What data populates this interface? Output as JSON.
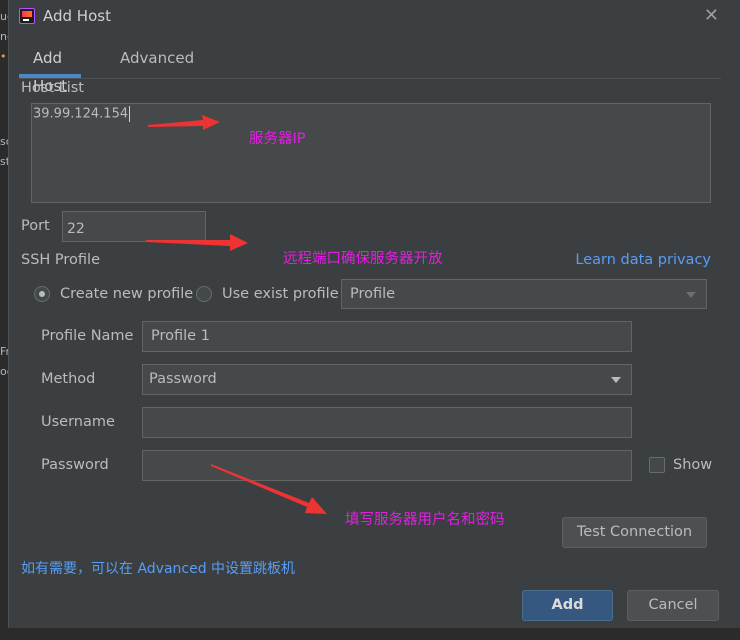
{
  "dialog": {
    "title": "Add Host",
    "tabs": [
      {
        "label": "Add Host",
        "active": true
      },
      {
        "label": "Advanced",
        "active": false
      }
    ]
  },
  "host_list": {
    "label": "Host List",
    "value": "39.99.124.154"
  },
  "port": {
    "label": "Port",
    "value": "22"
  },
  "ssh_profile": {
    "label": "SSH Profile",
    "privacy_link": "Learn data privacy",
    "create_new_label": "Create new profile",
    "use_exist_label": "Use exist profile",
    "profile_select": "Profile",
    "selected_option": "Create new profile"
  },
  "form": {
    "profile_name_label": "Profile Name",
    "profile_name_value": "Profile 1",
    "method_label": "Method",
    "method_value": "Password",
    "username_label": "Username",
    "username_value": "",
    "password_label": "Password",
    "password_value": "",
    "show_label": "Show"
  },
  "buttons": {
    "test_connection": "Test Connection",
    "add": "Add",
    "cancel": "Cancel"
  },
  "footer_note": "如有需要，可以在 Advanced 中设置跳板机",
  "annotations": {
    "server_ip": "服务器IP",
    "port_note": "远程端口确保服务器开放",
    "credentials": "填写服务器用户名和密码"
  },
  "colors": {
    "background": "#3c3f41",
    "accent": "#4a88c7",
    "link": "#589df6",
    "annotation": "#e020e0",
    "arrow": "#ee3333"
  }
}
